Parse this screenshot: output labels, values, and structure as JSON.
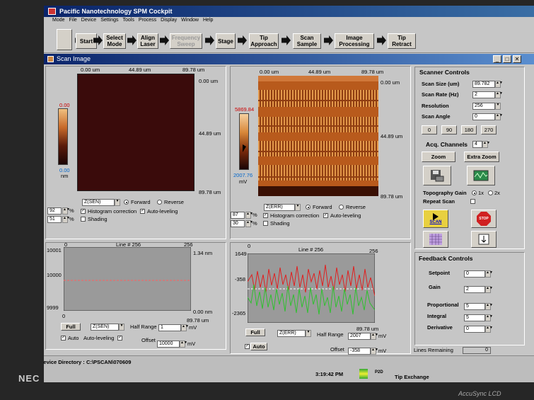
{
  "app": {
    "title": "Pacific Nanotechnology SPM Cockpit"
  },
  "menu": [
    "Mode",
    "File",
    "Device",
    "Settings",
    "Tools",
    "Process",
    "Display",
    "Window",
    "Help"
  ],
  "toolbar": {
    "start": "Start",
    "select_mode": "Select\nMode",
    "align_laser": "Align\nLaser",
    "frequency_sweep": "Frequency\nSweep",
    "stage": "Stage",
    "tip_approach": "Tip\nApproach",
    "scan_sample": "Scan\nSample",
    "image_processing": "Image\nProcessing",
    "tip_retract": "Tip\nRetract"
  },
  "window": {
    "title": "Scan Image"
  },
  "left_image": {
    "x_ticks": [
      "0.00 um",
      "44.89 um",
      "89.78 um"
    ],
    "y_ticks": [
      "0.00 um",
      "44.89 um",
      "89.78 um"
    ],
    "scale_max": "0.00",
    "scale_min": "0.00",
    "scale_unit": "nm",
    "channel": "Z(SEN)",
    "forward": "Forward",
    "reverse": "Reverse",
    "spin1": "92",
    "spin2": "51",
    "pct": "%",
    "histogram": "Histogram correction",
    "autolevel": "Auto-leveling",
    "shading": "Shading"
  },
  "right_image": {
    "x_ticks": [
      "0.00 um",
      "44.89 um",
      "89.78 um"
    ],
    "y_ticks": [
      "0.00 um",
      "44.89 um",
      "89.78 um"
    ],
    "scale_max": "5869.84",
    "scale_min": "2007.76",
    "scale_unit": "mV",
    "channel": "Z(ERR)",
    "forward": "Forward",
    "reverse": "Reverse",
    "spin1": "87",
    "spin2": "30",
    "pct": "%",
    "histogram": "Histogram correction",
    "autolevel": "Auto-leveling",
    "shading": "Shading"
  },
  "left_line": {
    "x0": "0",
    "line": "Line # 256",
    "x1": "256",
    "ymax": "10001",
    "ymid": "10000",
    "ymin": "9999",
    "rmax": "1.34 nm",
    "rmin": "0.00 nm",
    "bx0": "0",
    "bx1": "89.78 um",
    "full": "Full",
    "channel": "Z(SEN)",
    "half_range": "Half Range",
    "hr_value": "1",
    "hr_unit": "mV",
    "auto": "Auto",
    "autolevel": "Auto-leveling",
    "offset": "Offset",
    "offset_value": "10000",
    "offset_unit": "mV"
  },
  "right_line": {
    "x0": "0",
    "line": "Line # 256",
    "x1": "256",
    "ymax": "1649",
    "ymid": "-358",
    "ymin": "-2365",
    "bx1": "89.78 um",
    "full": "Full",
    "channel": "Z(ERR)",
    "half_range": "Half Range",
    "hr_value": "2007",
    "hr_unit": "mV",
    "auto": "Auto",
    "offset": "Offset",
    "offset_value": "-358",
    "offset_unit": "mV"
  },
  "scanner": {
    "title": "Scanner Controls",
    "scan_size": "Scan Size (um)",
    "scan_size_v": "89.782",
    "scan_rate": "Scan Rate (Hz)",
    "scan_rate_v": "2",
    "resolution": "Resolution",
    "resolution_v": "256",
    "scan_angle": "Scan Angle",
    "scan_angle_v": "0",
    "angles": [
      "0",
      "90",
      "180",
      "270"
    ],
    "acq": "Acq. Channels",
    "acq_v": "4",
    "zoom": "Zoom",
    "extra_zoom": "Extra Zoom",
    "topo_gain": "Topography Gain",
    "gain_1x": "1x",
    "gain_2x": "2x",
    "repeat_scan": "Repeat Scan",
    "scan": "SCAN",
    "stop": "STOP"
  },
  "feedback": {
    "title": "Feedback Controls",
    "setpoint": "Setpoint",
    "setpoint_v": "0",
    "gain": "Gain",
    "gain_v": "2",
    "proportional": "Proportional",
    "proportional_v": "5",
    "integral": "Integral",
    "integral_v": "5",
    "derivative": "Derivative",
    "derivative_v": "0",
    "lines_remaining": "Lines Remaining",
    "lines_remaining_v": "0"
  },
  "status": {
    "device_dir": "Device Directory :",
    "device_dir_v": "C:\\PSCAN\\070609",
    "time": "3:19:42 PM",
    "tip_exchange": "Tip Exchange",
    "p2d": "P2D"
  },
  "monitor": {
    "brand": "NEC",
    "model": "AccuSync LCD"
  },
  "colors": {
    "titlebar": "#0a246a",
    "afm_orange": "#d87a2a",
    "line_red": "#e02020",
    "line_green": "#30c030"
  }
}
